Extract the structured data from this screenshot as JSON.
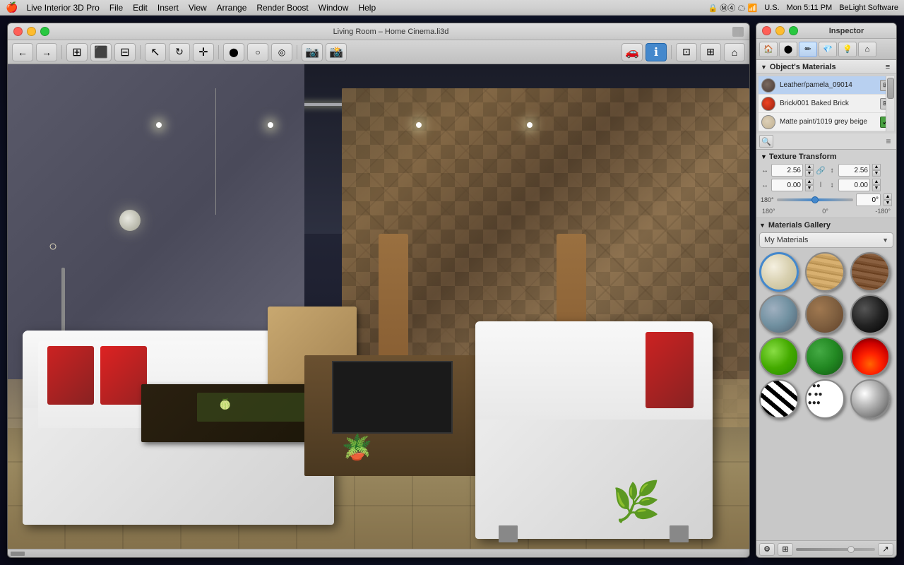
{
  "menubar": {
    "apple": "⌘",
    "items": [
      "Live Interior 3D Pro",
      "File",
      "Edit",
      "Insert",
      "View",
      "Arrange",
      "Render Boost",
      "Window",
      "Help"
    ],
    "right": {
      "status_icons": "🔒 ⓂⓃ ☁ 📶",
      "network": "U.S.",
      "time": "Mon 5:11 PM",
      "brand": "BeLight Software"
    }
  },
  "viewport": {
    "title": "Living Room – Home Cinema.li3d",
    "traffic_lights": {
      "close": "close",
      "minimize": "minimize",
      "maximize": "maximize"
    }
  },
  "toolbar": {
    "back_btn": "←",
    "fwd_btn": "→"
  },
  "inspector": {
    "title": "Inspector",
    "tabs": [
      {
        "label": "🏠",
        "name": "home"
      },
      {
        "label": "⬤",
        "name": "sphere"
      },
      {
        "label": "✏️",
        "name": "edit"
      },
      {
        "label": "💎",
        "name": "material"
      },
      {
        "label": "💡",
        "name": "light"
      },
      {
        "label": "⬜",
        "name": "layout"
      }
    ],
    "objects_materials": {
      "title": "Object's Materials",
      "items": [
        {
          "name": "Leather/pamela_09014",
          "swatch_color": "#5a5050",
          "has_icon": false
        },
        {
          "name": "Brick/001 Baked Brick",
          "swatch_color": "#cc3322",
          "has_icon": false
        },
        {
          "name": "Matte paint/1019 grey beige",
          "swatch_color": "#d4c8b0",
          "has_icon": true
        }
      ],
      "action_btn": "🔍"
    },
    "texture_transform": {
      "title": "Texture Transform",
      "scale_x": "2.56",
      "scale_y": "2.56",
      "offset_x": "0.00",
      "offset_y": "0.00",
      "angle": "0°",
      "angle_min": "180°",
      "angle_mid": "0°",
      "angle_max": "-180°"
    },
    "materials_gallery": {
      "title": "Materials Gallery",
      "dropdown": "My Materials",
      "items": [
        {
          "style": "mat-cream",
          "name": "cream-material"
        },
        {
          "style": "mat-wood-light",
          "name": "wood-light-material"
        },
        {
          "style": "mat-wood-dark",
          "name": "wood-dark-material"
        },
        {
          "style": "mat-stone",
          "name": "stone-material"
        },
        {
          "style": "mat-brown",
          "name": "brown-material"
        },
        {
          "style": "mat-black",
          "name": "black-material"
        },
        {
          "style": "mat-green-bright",
          "name": "green-bright-material"
        },
        {
          "style": "mat-green-dark",
          "name": "green-dark-material"
        },
        {
          "style": "mat-fire",
          "name": "fire-material"
        },
        {
          "style": "mat-zebra",
          "name": "zebra-material"
        },
        {
          "style": "mat-spots",
          "name": "spots-material"
        },
        {
          "style": "mat-chrome",
          "name": "chrome-material"
        }
      ]
    }
  }
}
